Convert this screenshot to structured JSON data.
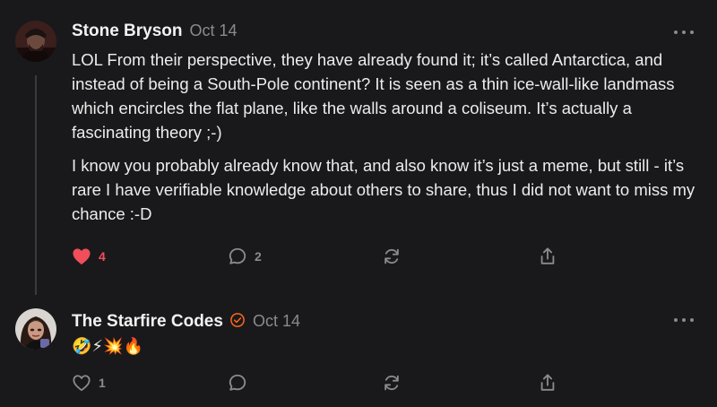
{
  "posts": [
    {
      "author": "Stone Bryson",
      "date": "Oct 14",
      "paragraphs": [
        "LOL From their perspective, they have already found it; it’s called Antarctica, and instead of being a South-Pole continent? It is seen as a thin ice-wall-like landmass which encircles the flat plane, like the walls around a coliseum. It’s actually a fascinating theory ;-)",
        "I know you probably already know that, and also know it’s just a meme, but still - it’s rare I have verifiable knowledge about others to share, thus I did not want to miss my chance :-D"
      ],
      "likes": "4",
      "liked": true,
      "comments": "2",
      "icons": [
        "heart-icon",
        "comment-icon",
        "restack-icon",
        "share-icon",
        "more-icon"
      ]
    },
    {
      "author": "The Starfire Codes",
      "date": "Oct 14",
      "verified": true,
      "text": "🤣⚡💥🔥",
      "likes": "1",
      "liked": false,
      "comments": "",
      "icons": [
        "heart-icon",
        "comment-icon",
        "restack-icon",
        "share-icon",
        "more-icon"
      ]
    }
  ],
  "colors": {
    "background": "#19191b",
    "liked": "#f04e5a",
    "muted": "#8a8a8f",
    "verified": "#ff6719"
  }
}
